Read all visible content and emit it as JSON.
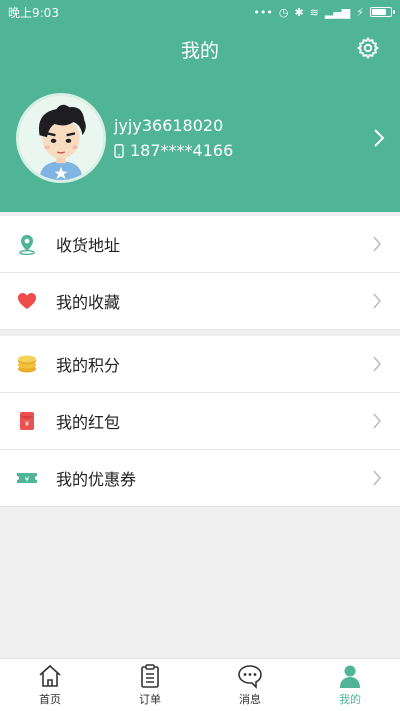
{
  "status_bar": {
    "time": "晚上9:03"
  },
  "header": {
    "title": "我的"
  },
  "profile": {
    "username": "jyjy36618020",
    "phone": "187****4166"
  },
  "menu_groups": [
    [
      {
        "label": "收货地址",
        "icon": "location-pin-icon"
      },
      {
        "label": "我的收藏",
        "icon": "heart-icon"
      }
    ],
    [
      {
        "label": "我的积分",
        "icon": "coins-icon"
      },
      {
        "label": "我的红包",
        "icon": "red-envelope-icon"
      },
      {
        "label": "我的优惠券",
        "icon": "coupon-icon"
      }
    ]
  ],
  "tabs": [
    {
      "label": "首页",
      "icon": "home-icon"
    },
    {
      "label": "订单",
      "icon": "clipboard-icon"
    },
    {
      "label": "消息",
      "icon": "chat-bubble-icon"
    },
    {
      "label": "我的",
      "icon": "person-icon"
    }
  ],
  "colors": {
    "primary": "#4fb596",
    "location": "#4fb596",
    "heart": "#ef4b4b",
    "coins": "#f3c13a",
    "red_envelope": "#ea5252",
    "coupon": "#4fb596"
  }
}
